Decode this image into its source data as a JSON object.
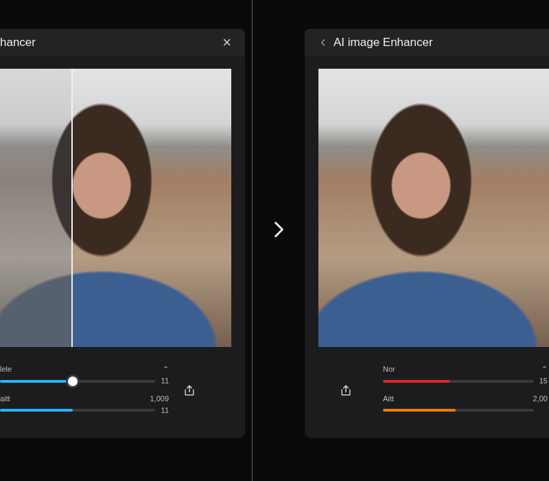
{
  "panels": [
    {
      "kind": "compare",
      "title": "hancer",
      "close": "×",
      "sliders": [
        {
          "label": "lele",
          "top": "⌃",
          "reading": "11",
          "level": 0.47,
          "color": "#29b6f6",
          "knob": true
        },
        {
          "label": "aitt",
          "top": "1,009",
          "reading": "11",
          "level": 0.47,
          "color": "#29b6f6",
          "knob": false
        }
      ]
    },
    {
      "kind": "result",
      "title": "AI image Enhancer",
      "sliders": [
        {
          "label": "Nor",
          "top": "⌃",
          "reading": "15",
          "level": 0.44,
          "color": "#e0281e",
          "knob": false
        },
        {
          "label": "Aitt",
          "top": "2,00",
          "level": 0.48,
          "color": "#f57c00",
          "knob": false
        }
      ]
    }
  ]
}
